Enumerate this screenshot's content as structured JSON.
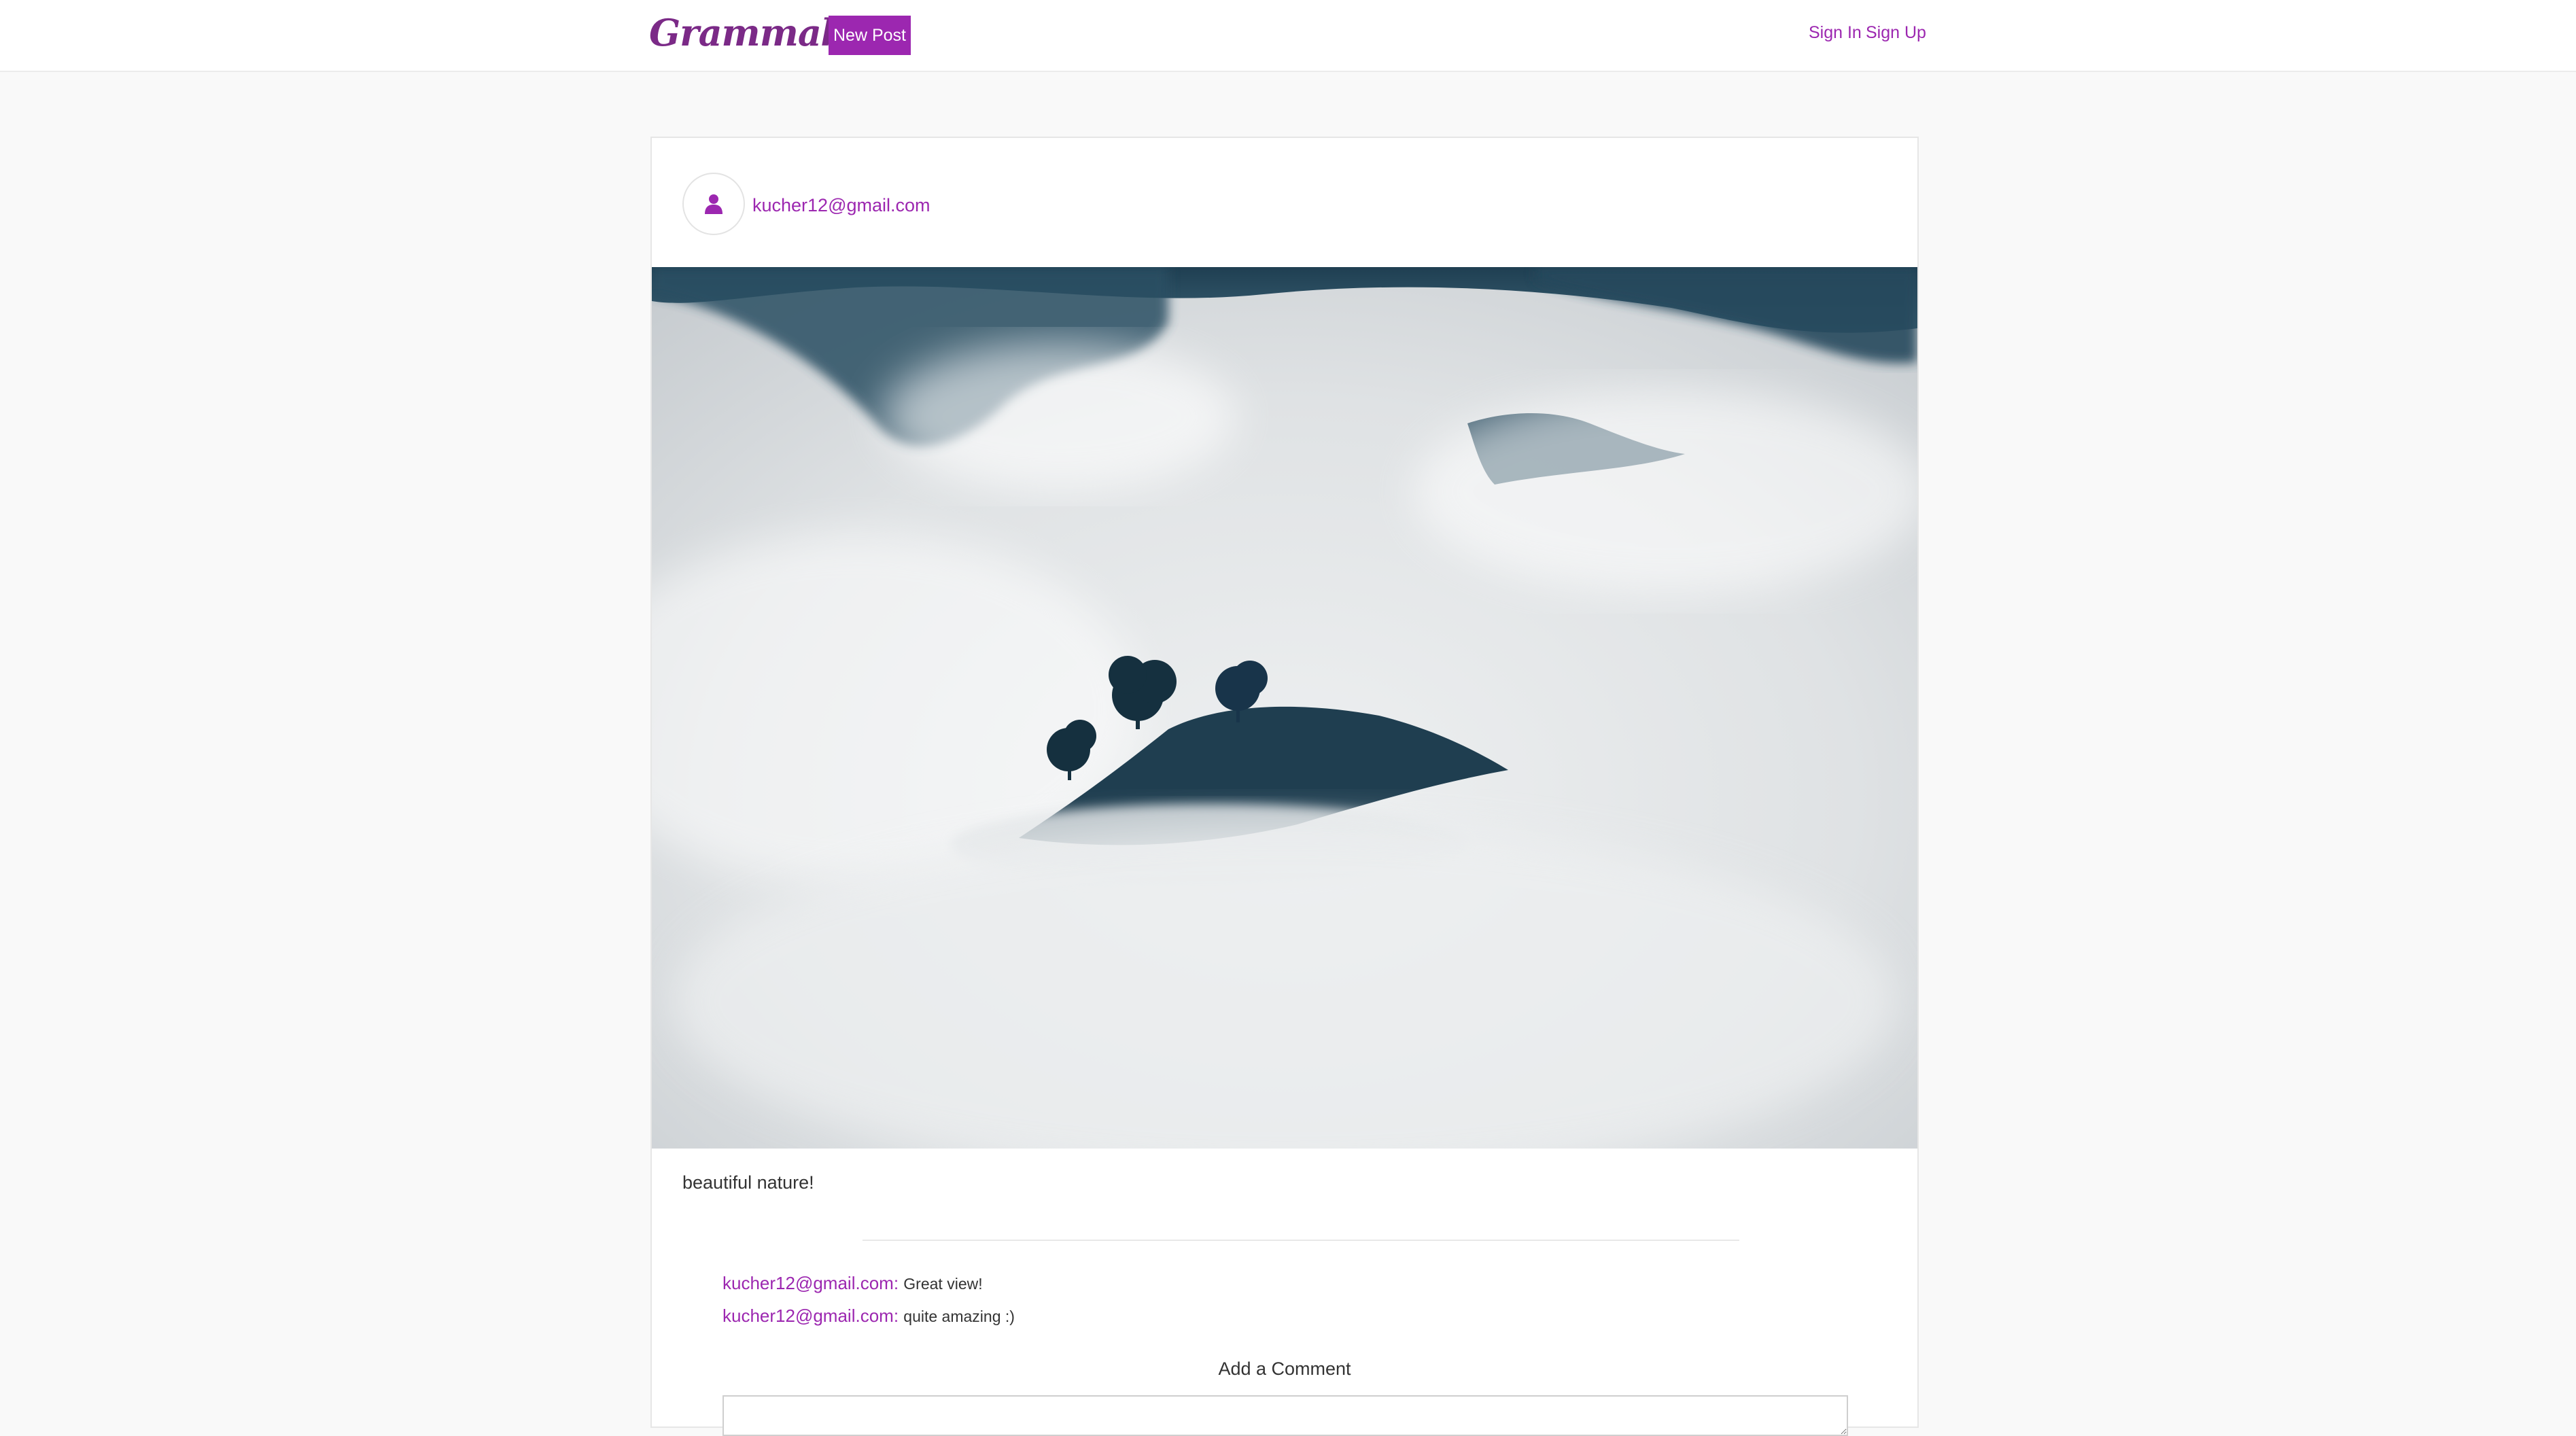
{
  "nav": {
    "logo": "Grammable",
    "new_post_label": "New Post",
    "sign_in_label": "Sign In",
    "sign_up_label": "Sign Up",
    "accent_color": "#9c27b0"
  },
  "post": {
    "author": "kucher12@gmail.com",
    "avatar_icon": "user-icon",
    "image_subject": "photo-image",
    "caption": "beautiful nature!",
    "comments": [
      {
        "user": "kucher12@gmail.com:",
        "text": "Great view!"
      },
      {
        "user": "kucher12@gmail.com:",
        "text": "quite amazing :)"
      }
    ],
    "add_comment_label": "Add a Comment",
    "comment_input_value": ""
  }
}
